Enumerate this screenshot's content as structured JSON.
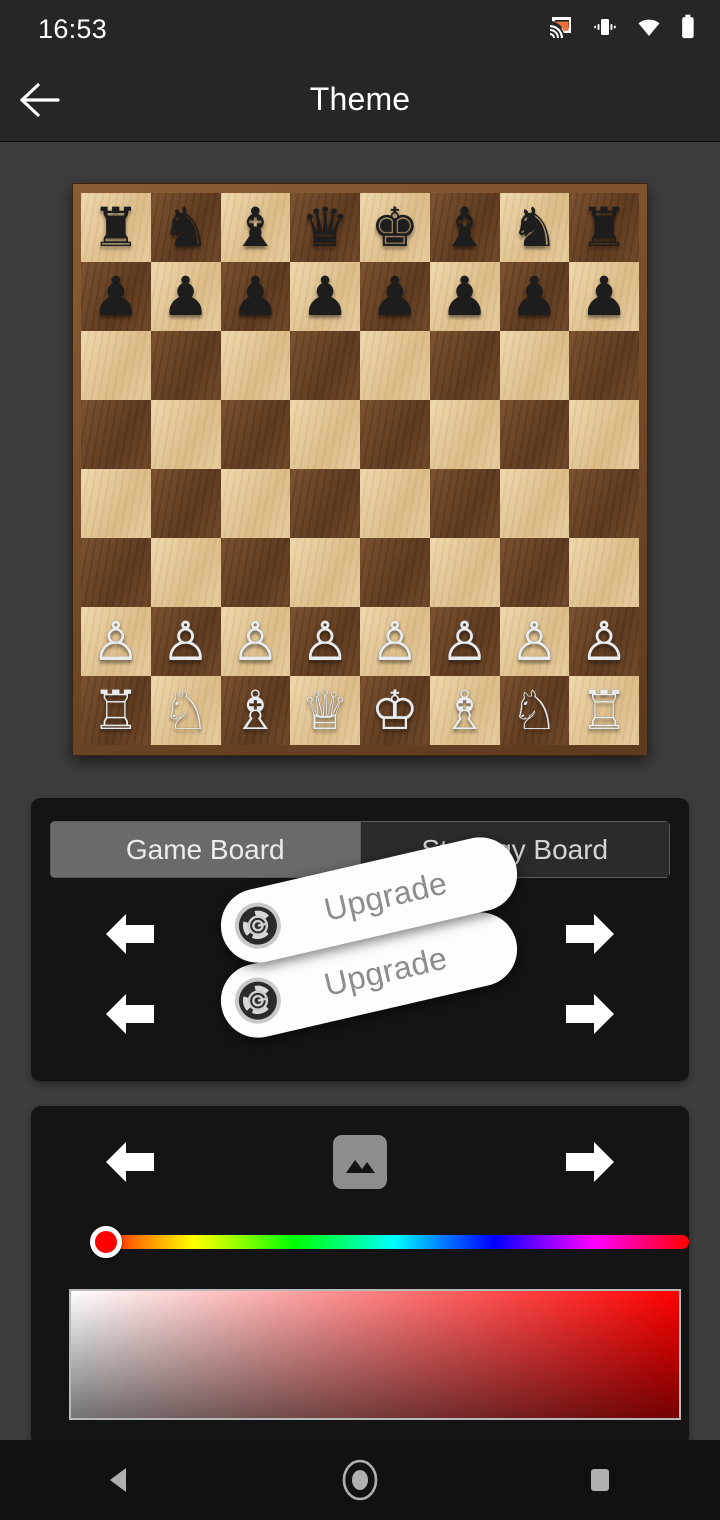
{
  "status_bar": {
    "clock": "16:53",
    "icons": [
      "cast-icon",
      "vibrate-icon",
      "wifi-icon",
      "battery-icon"
    ],
    "cast_color": "#f0703c",
    "background": "#262626"
  },
  "toolbar": {
    "title": "Theme",
    "back_icon": "back-arrow-icon",
    "background": "#262626"
  },
  "board": {
    "name": "chess-board-preview",
    "light_square_color": "#e0c89a",
    "dark_square_color": "#6e4a2e",
    "frame_color": "#6f4622",
    "rows": [
      [
        "r",
        "n",
        "b",
        "q",
        "k",
        "b",
        "n",
        "r"
      ],
      [
        "p",
        "p",
        "p",
        "p",
        "p",
        "p",
        "p",
        "p"
      ],
      [
        "",
        "",
        "",
        "",
        "",
        "",
        "",
        ""
      ],
      [
        "",
        "",
        "",
        "",
        "",
        "",
        "",
        ""
      ],
      [
        "",
        "",
        "",
        "",
        "",
        "",
        "",
        ""
      ],
      [
        "",
        "",
        "",
        "",
        "",
        "",
        "",
        ""
      ],
      [
        "P",
        "P",
        "P",
        "P",
        "P",
        "P",
        "P",
        "P"
      ],
      [
        "R",
        "N",
        "B",
        "Q",
        "K",
        "B",
        "N",
        "R"
      ]
    ],
    "glyphs": {
      "r": "♜",
      "n": "♞",
      "b": "♝",
      "q": "♛",
      "k": "♚",
      "p": "♟",
      "R": "♖",
      "N": "♘",
      "B": "♗",
      "Q": "♕",
      "K": "♔",
      "P": "♙"
    }
  },
  "boards_panel": {
    "name": "board-theme-panel",
    "background": "#141414",
    "tabs": [
      {
        "label": "Game Board",
        "selected": true
      },
      {
        "label": "Strategy Board",
        "selected": false
      }
    ],
    "rows": [
      {
        "prev_icon": "left-arrow-icon",
        "next_icon": "right-arrow-icon"
      },
      {
        "prev_icon": "left-arrow-icon",
        "next_icon": "right-arrow-icon"
      }
    ],
    "upgrades": [
      {
        "label": "Upgrade",
        "icon": "target-badge-icon"
      },
      {
        "label": "Upgrade",
        "icon": "target-badge-icon"
      }
    ]
  },
  "background_panel": {
    "name": "background-theme-panel",
    "background": "#141414",
    "prev_icon": "left-arrow-icon",
    "next_icon": "right-arrow-icon",
    "picker_icon": "image-placeholder-icon",
    "hue_slider": {
      "name": "hue-slider",
      "value": 0,
      "thumb_color": "#ff0000"
    },
    "sv_box": {
      "name": "saturation-value-picker",
      "base_color": "#ff0000"
    }
  },
  "nav_bar": {
    "background": "#111111",
    "buttons": [
      {
        "name": "nav-back-button",
        "icon": "triangle-back-icon"
      },
      {
        "name": "nav-home-button",
        "icon": "circle-home-icon"
      },
      {
        "name": "nav-recents-button",
        "icon": "square-recents-icon"
      }
    ]
  },
  "page": {
    "background": "#3d3d3d"
  }
}
